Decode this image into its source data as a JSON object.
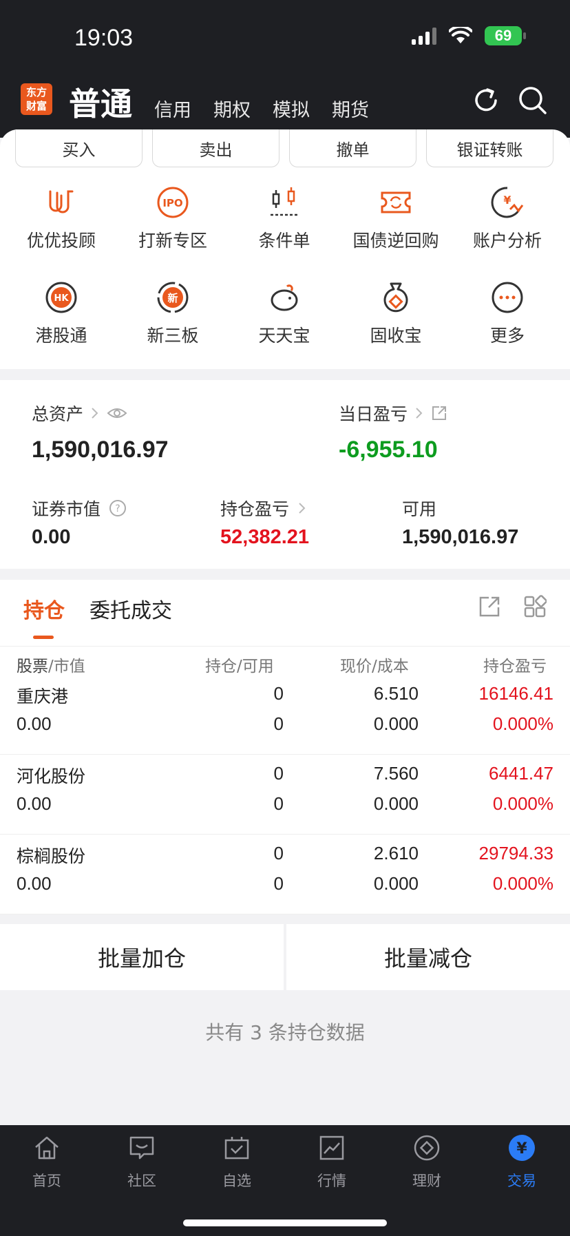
{
  "status_bar": {
    "time": "19:03",
    "battery": "69"
  },
  "header": {
    "logo_line1": "东方",
    "logo_line2": "财富",
    "tabs": [
      "普通",
      "信用",
      "期权",
      "模拟",
      "期货"
    ],
    "active_tab": "普通"
  },
  "trade_actions": [
    "买入",
    "卖出",
    "撤单",
    "银证转账"
  ],
  "services": [
    {
      "label": "优优投顾",
      "icon": "uu-advisor-icon"
    },
    {
      "label": "打新专区",
      "icon": "ipo-icon"
    },
    {
      "label": "条件单",
      "icon": "condition-order-icon"
    },
    {
      "label": "国债逆回购",
      "icon": "repo-icon"
    },
    {
      "label": "账户分析",
      "icon": "account-analysis-icon"
    },
    {
      "label": "港股通",
      "icon": "hk-connect-icon"
    },
    {
      "label": "新三板",
      "icon": "neeq-icon"
    },
    {
      "label": "天天宝",
      "icon": "piggy-bank-icon"
    },
    {
      "label": "固收宝",
      "icon": "money-bag-icon"
    },
    {
      "label": "更多",
      "icon": "more-icon"
    }
  ],
  "assets": {
    "total_label": "总资产",
    "total_value": "1,590,016.97",
    "daily_pl_label": "当日盈亏",
    "daily_pl_value": "-6,955.10",
    "market_value_label": "证券市值",
    "market_value": "0.00",
    "position_pl_label": "持仓盈亏",
    "position_pl_value": "52,382.21",
    "available_label": "可用",
    "available_value": "1,590,016.97"
  },
  "positions": {
    "tabs": [
      "持仓",
      "委托成交"
    ],
    "headers": {
      "stock": "股票",
      "market_value": "/市值",
      "hold": "持仓",
      "avail": "/可用",
      "price": "现价",
      "cost": "/成本",
      "pl": "持仓盈亏"
    },
    "rows": [
      {
        "name": "重庆港",
        "mv": "0.00",
        "hold": "0",
        "avail": "0",
        "price": "6.510",
        "cost": "0.000",
        "pl": "16146.41",
        "pl_pct": "0.000%"
      },
      {
        "name": "河化股份",
        "mv": "0.00",
        "hold": "0",
        "avail": "0",
        "price": "7.560",
        "cost": "0.000",
        "pl": "6441.47",
        "pl_pct": "0.000%"
      },
      {
        "name": "棕榈股份",
        "mv": "0.00",
        "hold": "0",
        "avail": "0",
        "price": "2.610",
        "cost": "0.000",
        "pl": "29794.33",
        "pl_pct": "0.000%"
      }
    ]
  },
  "bulk": {
    "add": "批量加仓",
    "reduce": "批量减仓"
  },
  "summary": "共有 3 条持仓数据",
  "tabbar": [
    "首页",
    "社区",
    "自选",
    "行情",
    "理财",
    "交易"
  ],
  "colors": {
    "accent": "#e9581e",
    "up": "#e3131e",
    "down": "#0d9c1f",
    "active_tab": "#2b7cf6"
  }
}
